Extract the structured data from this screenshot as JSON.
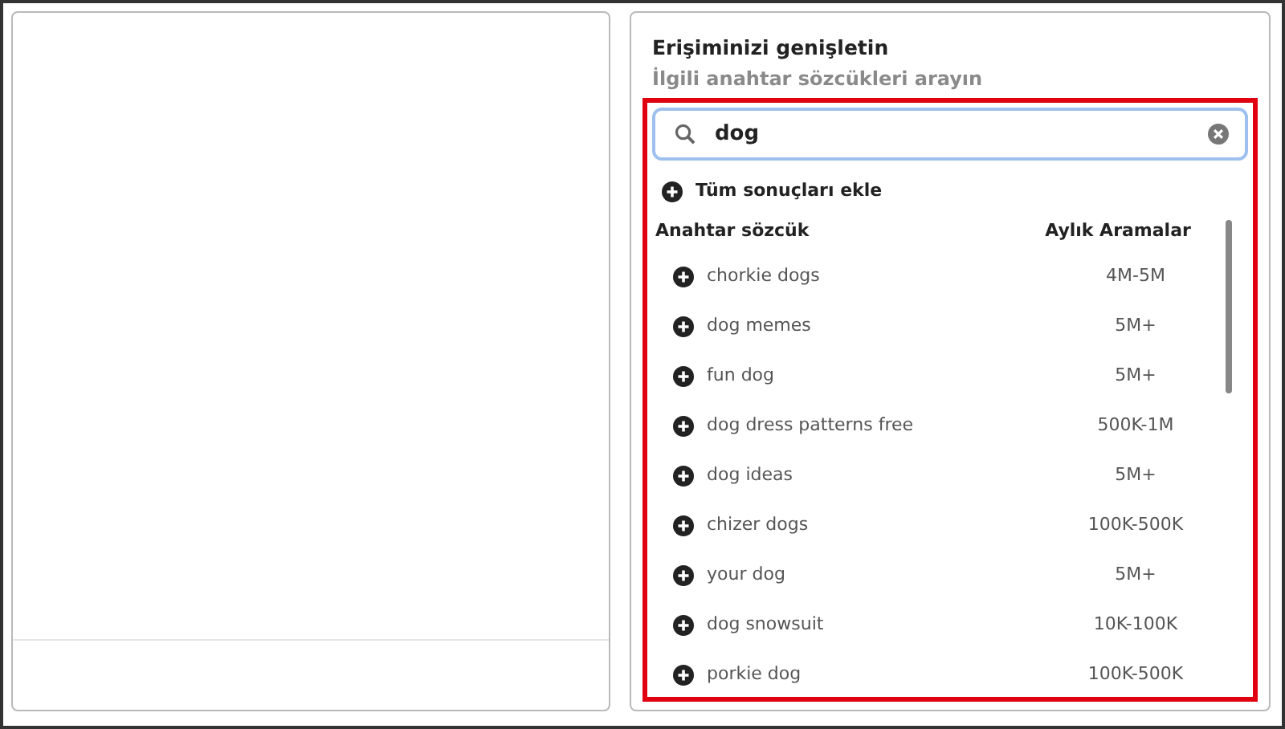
{
  "panel": {
    "title": "Erişiminizi genişletin",
    "subtitle": "İlgili anahtar sözcükleri arayın"
  },
  "search": {
    "value": "dog",
    "focused": true
  },
  "add_all": {
    "label": "Tüm sonuçları ekle"
  },
  "table": {
    "columns": [
      "Anahtar sözcük",
      "Aylık Aramalar"
    ],
    "rows": [
      {
        "keyword": "chorkie dogs",
        "searches": "4M-5M"
      },
      {
        "keyword": "dog memes",
        "searches": "5M+"
      },
      {
        "keyword": "fun dog",
        "searches": "5M+"
      },
      {
        "keyword": "dog dress patterns free",
        "searches": "500K-1M"
      },
      {
        "keyword": "dog ideas",
        "searches": "5M+"
      },
      {
        "keyword": "chizer dogs",
        "searches": "100K-500K"
      },
      {
        "keyword": "your dog",
        "searches": "5M+"
      },
      {
        "keyword": "dog snowsuit",
        "searches": "10K-100K"
      },
      {
        "keyword": "porkie dog",
        "searches": "100K-500K"
      }
    ]
  }
}
